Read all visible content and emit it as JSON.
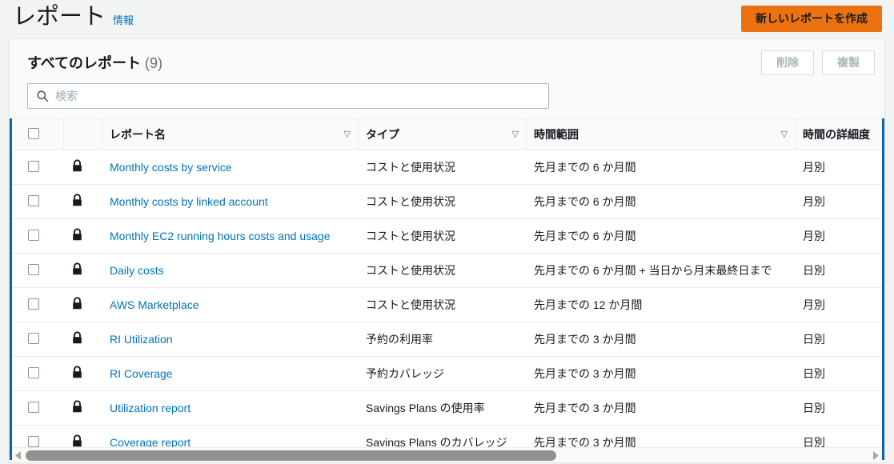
{
  "header": {
    "title": "レポート",
    "info_link": "情報",
    "create_button": "新しいレポートを作成"
  },
  "collection": {
    "title": "すべてのレポート",
    "count": "(9)",
    "actions": {
      "delete": "削除",
      "duplicate": "複製"
    },
    "search": {
      "placeholder": "検索",
      "value": "",
      "icon": "search-icon"
    }
  },
  "table": {
    "columns": [
      {
        "label": "",
        "key": "select",
        "sortable": false
      },
      {
        "label": "",
        "key": "lock",
        "sortable": false
      },
      {
        "label": "レポート名",
        "key": "name",
        "sortable": true,
        "sort_icon": "▽"
      },
      {
        "label": "タイプ",
        "key": "type",
        "sortable": true,
        "sort_icon": "▽"
      },
      {
        "label": "時間範囲",
        "key": "range",
        "sortable": true,
        "sort_icon": "▽"
      },
      {
        "label": "時間の詳細度",
        "key": "granularity",
        "sortable": false
      }
    ],
    "select_all_checked": false,
    "rows": [
      {
        "checked": false,
        "lock_icon": "lock-icon",
        "name": "Monthly costs by service",
        "type": "コストと使用状況",
        "range": "先月までの 6 か月間",
        "granularity": "月別"
      },
      {
        "checked": false,
        "lock_icon": "lock-icon",
        "name": "Monthly costs by linked account",
        "type": "コストと使用状況",
        "range": "先月までの 6 か月間",
        "granularity": "月別"
      },
      {
        "checked": false,
        "lock_icon": "lock-icon",
        "name": "Monthly EC2 running hours costs and usage",
        "type": "コストと使用状況",
        "range": "先月までの 6 か月間",
        "granularity": "月別"
      },
      {
        "checked": false,
        "lock_icon": "lock-icon",
        "name": "Daily costs",
        "type": "コストと使用状況",
        "range": "先月までの 6 か月間 + 当日から月末最終日まで",
        "granularity": "日別"
      },
      {
        "checked": false,
        "lock_icon": "lock-icon",
        "name": "AWS Marketplace",
        "type": "コストと使用状況",
        "range": "先月までの 12 か月間",
        "granularity": "月別"
      },
      {
        "checked": false,
        "lock_icon": "lock-icon",
        "name": "RI Utilization",
        "type": "予約の利用率",
        "range": "先月までの 3 か月間",
        "granularity": "日別"
      },
      {
        "checked": false,
        "lock_icon": "lock-icon",
        "name": "RI Coverage",
        "type": "予約カバレッジ",
        "range": "先月までの 3 か月間",
        "granularity": "日別"
      },
      {
        "checked": false,
        "lock_icon": "lock-icon",
        "name": "Utilization report",
        "type": "Savings Plans の使用率",
        "range": "先月までの 3 か月間",
        "granularity": "日別"
      },
      {
        "checked": false,
        "lock_icon": "lock-icon",
        "name": "Coverage report",
        "type": "Savings Plans のカバレッジ",
        "range": "先月までの 3 か月間",
        "granularity": "日別"
      }
    ]
  },
  "scrollbar": {
    "left_arrow_icon": "triangle-left-icon",
    "right_arrow_icon": "triangle-right-icon",
    "thumb_percent": "63"
  },
  "colors": {
    "accent_orange": "#ec7211",
    "link_blue": "#0073bb",
    "focus_blue": "#0a65a8",
    "page_bg": "#f2f3f3"
  }
}
